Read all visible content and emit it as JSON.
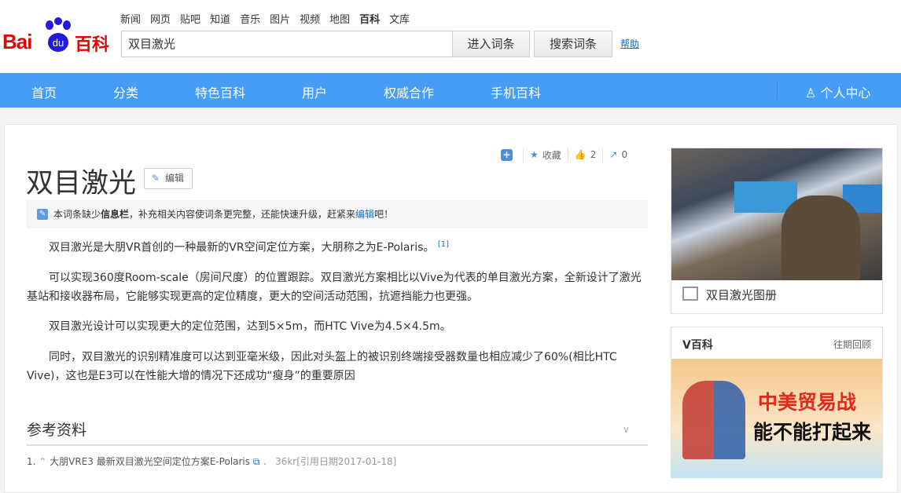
{
  "header": {
    "logo": "Baidu百科",
    "nav_links": [
      "新闻",
      "网页",
      "贴吧",
      "知道",
      "音乐",
      "图片",
      "视频",
      "地图",
      "百科",
      "文库"
    ],
    "active_nav": "百科",
    "search_value": "双目激光",
    "enter_button": "进入词条",
    "search_button": "搜索词条",
    "help": "帮助"
  },
  "menu": {
    "items": [
      "首页",
      "分类",
      "特色百科",
      "用户",
      "权威合作",
      "手机百科"
    ],
    "user_center": "个人中心"
  },
  "article": {
    "title": "双目激光",
    "edit": "编辑",
    "tools": {
      "favorite": "收藏",
      "likes": "2",
      "shares": "0"
    },
    "notice": {
      "prefix": "本词条缺少",
      "bold": "信息栏",
      "middle": "，补充相关内容使词条更完整，还能快速升级，赶紧来",
      "link": "编辑",
      "suffix": "吧！"
    },
    "paragraphs": [
      "双目激光是大朋VR首创的一种最新的VR空间定位方案，大朋称之为E-Polaris。",
      "可以实现360度Room-scale（房间尺度）的位置跟踪。双目激光方案相比以Vive为代表的单目激光方案，全新设计了激光基站和接收器布局，它能够实现更高的定位精度，更大的空间活动范围，抗遮挡能力也更强。",
      "双目激光设计可以实现更大的定位范围，达到5×5m，而HTC Vive为4.5×4.5m。",
      "同时，双目激光的识别精准度可以达到亚毫米级，因此对头盔上的被识别终端接受器数量也相应减少了60%(相比HTC Vive)，这也是E3可以在性能大增的情况下还成功“瘦身”的重要原因"
    ],
    "footnote": "[1]",
    "references_title": "参考资料",
    "references": [
      {
        "num": "1.",
        "title": "大朋VRE3 最新双目激光空间定位方案E-Polaris",
        "source": "．  36kr[引用日期2017-01-18]"
      }
    ]
  },
  "sidebar": {
    "album_caption": "双目激光图册",
    "vbaike_title": "V百科",
    "vbaike_more": "往期回顾",
    "banner_line1": "中美贸易战",
    "banner_line2": "能不能打起来"
  }
}
